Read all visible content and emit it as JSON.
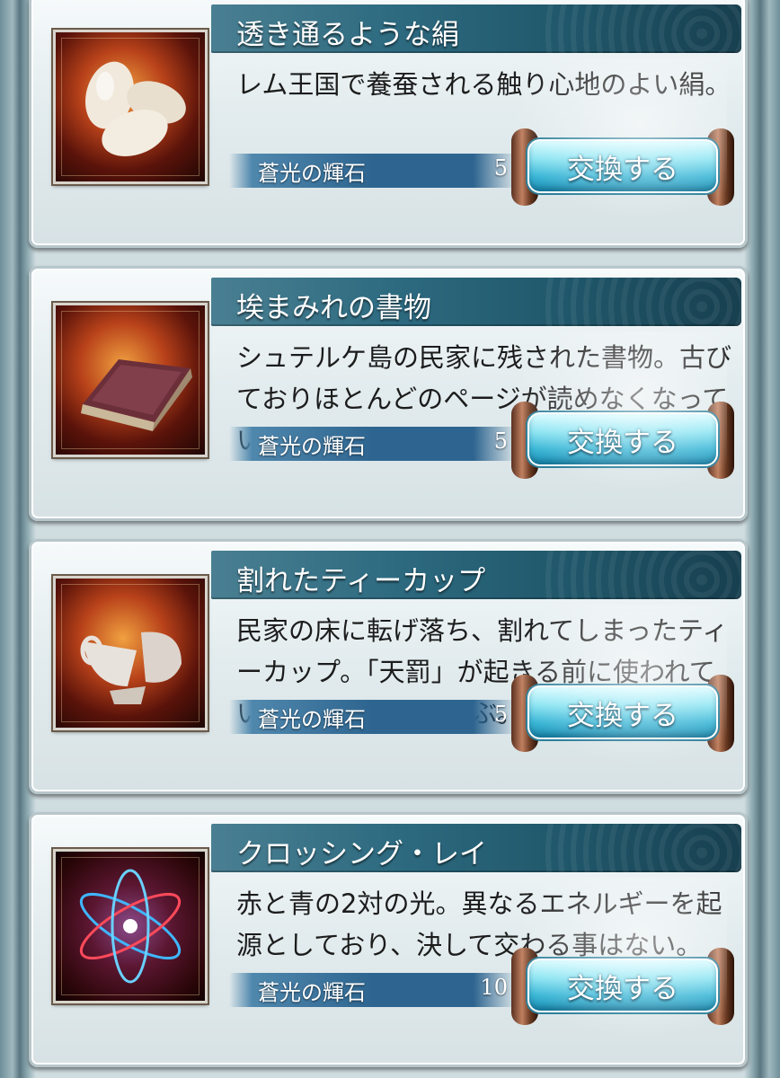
{
  "items": [
    {
      "name": "透き通るような絹",
      "description": "レム王国で養蚕される触り心地のよい絹。",
      "cost_currency": "蒼光の輝石",
      "cost_amount": "5",
      "button_label": "交換する",
      "icon": "silk-cocoon-icon"
    },
    {
      "name": "埃まみれの書物",
      "description": "シュテルケ島の民家に残された書物。古びておりほとんどのページが読めなくなっている。",
      "cost_currency": "蒼光の輝石",
      "cost_amount": "5",
      "button_label": "交換する",
      "icon": "dusty-book-icon"
    },
    {
      "name": "割れたティーカップ",
      "description": "民家の床に転げ落ち、割れてしまったティーカップ。「天罰」が起きる前に使われていた様子が目に浮かぶ。",
      "cost_currency": "蒼光の輝石",
      "cost_amount": "5",
      "button_label": "交換する",
      "icon": "broken-teacup-icon"
    },
    {
      "name": "クロッシング・レイ",
      "description": "赤と青の2対の光。異なるエネルギーを起源としており、決して交わる事はない。",
      "cost_currency": "蒼光の輝石",
      "cost_amount": "10",
      "button_label": "交換する",
      "icon": "crossing-ray-icon"
    }
  ]
}
